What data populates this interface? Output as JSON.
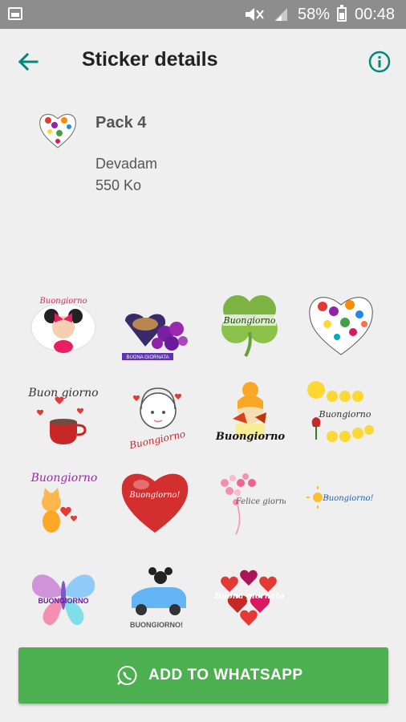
{
  "status_bar": {
    "battery_percent": "58%",
    "time": "00:48"
  },
  "header": {
    "title": "Sticker details",
    "back_icon": "arrow-left-icon",
    "info_icon": "info-circle-icon"
  },
  "pack": {
    "name": "Pack 4",
    "author": "Devadam",
    "size": "550 Ko"
  },
  "stickers": [
    {
      "name": "minnie-buongiorno",
      "text": "Buongiorno"
    },
    {
      "name": "coffee-purple-flowers",
      "text": "BUONA GIORNATA"
    },
    {
      "name": "green-clover",
      "text": "Buongiorno"
    },
    {
      "name": "flower-heart",
      "text": ""
    },
    {
      "name": "buongiorno-coffee-hearts",
      "text": "Buon giorno"
    },
    {
      "name": "sketch-girl",
      "text": "Buongiorno"
    },
    {
      "name": "golden-woman-leaves",
      "text": "Buongiorno"
    },
    {
      "name": "emoji-kisses",
      "text": "Buongiorno"
    },
    {
      "name": "kitten-hearts",
      "text": "Buongiorno"
    },
    {
      "name": "red-heart",
      "text": "Buongiorno!"
    },
    {
      "name": "pink-heart-felice-giornata",
      "text": "Felice giornata"
    },
    {
      "name": "buongiorno-sun",
      "text": "Buongiorno!"
    },
    {
      "name": "butterfly",
      "text": "BUONGIORNO"
    },
    {
      "name": "mickey-car",
      "text": "BUONGIORNO!"
    },
    {
      "name": "hearts-cluster",
      "text": "Buona giornata"
    }
  ],
  "footer": {
    "add_label": "ADD TO WHATSAPP",
    "icon": "whatsapp-icon"
  },
  "colors": {
    "accent": "#00897b",
    "button": "#4caf50",
    "status_bar": "#8d8d8d",
    "background": "#efefef"
  }
}
